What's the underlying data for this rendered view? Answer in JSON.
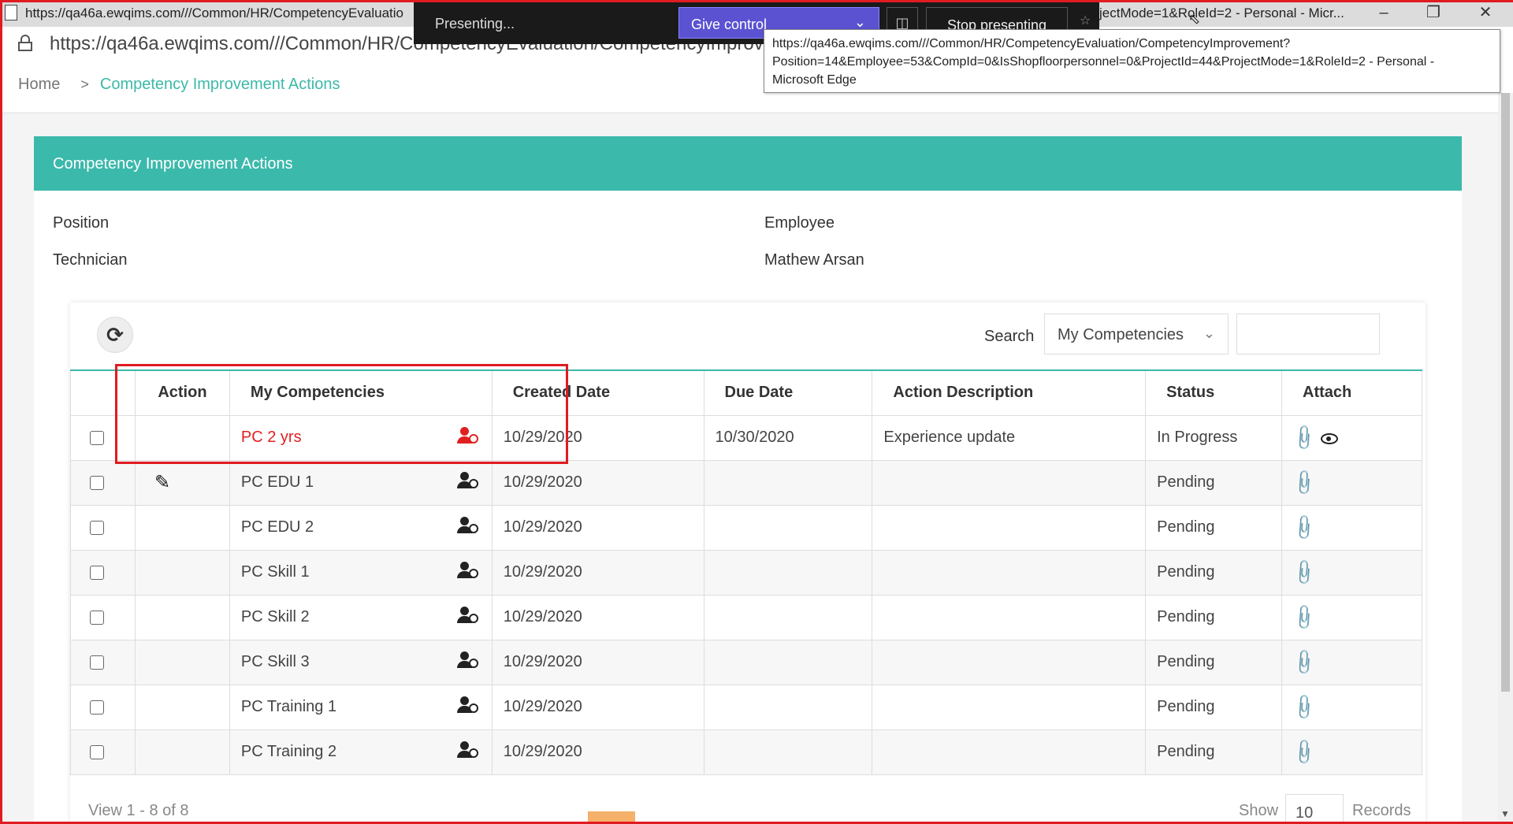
{
  "titlebar": {
    "title_left": "https://qa46a.ewqims.com///Common/HR/CompetencyEvaluatio",
    "title_right": "jectMode=1&RoleId=2 - Personal - Micr..."
  },
  "presenting": {
    "label": "Presenting...",
    "give_control": "Give control",
    "stop": "Stop presenting"
  },
  "address": {
    "url": "https://qa46a.ewqims.com///Common/HR/CompetencyEvaluation/CompetencyImprovement"
  },
  "tooltip": {
    "line1": "https://qa46a.ewqims.com///Common/HR/CompetencyEvaluation/CompetencyImprovement?",
    "line2": "Position=14&Employee=53&CompId=0&IsShopfloorpersonnel=0&ProjectId=44&ProjectMode=1&RoleId=2 - Personal -",
    "line3": "Microsoft Edge"
  },
  "breadcrumb": {
    "home": "Home",
    "separator": ">",
    "current": "Competency Improvement Actions"
  },
  "panel": {
    "title": "Competency Improvement Actions",
    "position_label": "Position",
    "position_value": "Technician",
    "employee_label": "Employee",
    "employee_value": "Mathew Arsan"
  },
  "search": {
    "label": "Search",
    "selected": "My Competencies"
  },
  "table": {
    "headers": {
      "action": "Action",
      "competency": "My Competencies",
      "created": "Created Date",
      "due": "Due Date",
      "description": "Action Description",
      "status": "Status",
      "attach": "Attach"
    },
    "rows": [
      {
        "competency": "PC 2 yrs",
        "created": "10/29/2020",
        "due": "10/30/2020",
        "description": "Experience update",
        "status": "In Progress"
      },
      {
        "competency": "PC EDU 1",
        "created": "10/29/2020",
        "due": "",
        "description": "",
        "status": "Pending"
      },
      {
        "competency": "PC EDU 2",
        "created": "10/29/2020",
        "due": "",
        "description": "",
        "status": "Pending"
      },
      {
        "competency": "PC Skill 1",
        "created": "10/29/2020",
        "due": "",
        "description": "",
        "status": "Pending"
      },
      {
        "competency": "PC Skill 2",
        "created": "10/29/2020",
        "due": "",
        "description": "",
        "status": "Pending"
      },
      {
        "competency": "PC Skill 3",
        "created": "10/29/2020",
        "due": "",
        "description": "",
        "status": "Pending"
      },
      {
        "competency": "PC Training 1",
        "created": "10/29/2020",
        "due": "",
        "description": "",
        "status": "Pending"
      },
      {
        "competency": "PC Training 2",
        "created": "10/29/2020",
        "due": "",
        "description": "",
        "status": "Pending"
      }
    ]
  },
  "footer": {
    "view": "View 1 - 8 of 8",
    "show": "Show",
    "show_value": "10",
    "records": "Records"
  },
  "colors": {
    "accent_teal": "#3bb9ab",
    "highlight_red": "#e01b22",
    "give_control_purple": "#5a52d1"
  }
}
